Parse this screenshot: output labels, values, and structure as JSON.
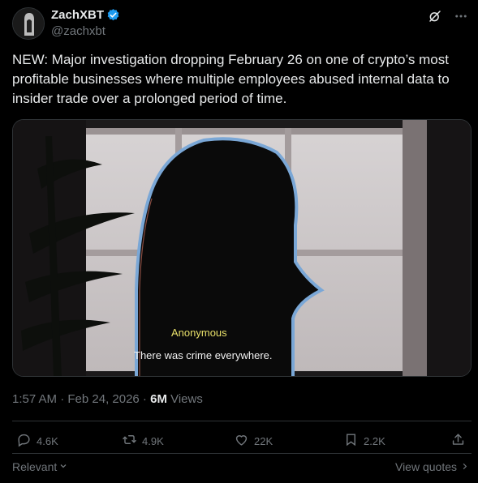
{
  "author": {
    "name": "ZachXBT",
    "handle": "@zachxbt"
  },
  "tweet": {
    "text": "NEW: Major investigation dropping February 26 on one of crypto’s most profitable businesses where multiple employees abused internal data to insider trade over a prolonged period of time."
  },
  "media": {
    "caption_name": "Anonymous",
    "caption_text": "There was crime everywhere."
  },
  "meta": {
    "timestamp": "1:57 AM · Feb 24, 2026 · ",
    "views_count": "6M",
    "views_label": " Views"
  },
  "actions": {
    "replies": "4.6K",
    "reposts": "4.9K",
    "likes": "22K",
    "bookmarks": "2.2K"
  },
  "footer": {
    "sort_label": "Relevant",
    "view_quotes": "View quotes"
  },
  "icons": {
    "verified": "verified-badge-icon",
    "grok": "grok-icon",
    "more": "more-icon",
    "reply": "reply-icon",
    "repost": "repost-icon",
    "like": "like-icon",
    "bookmark": "bookmark-icon",
    "share": "share-icon"
  },
  "colors": {
    "accent_blue": "#1d9bf0",
    "muted": "#71767b",
    "text": "#e7e9ea"
  }
}
